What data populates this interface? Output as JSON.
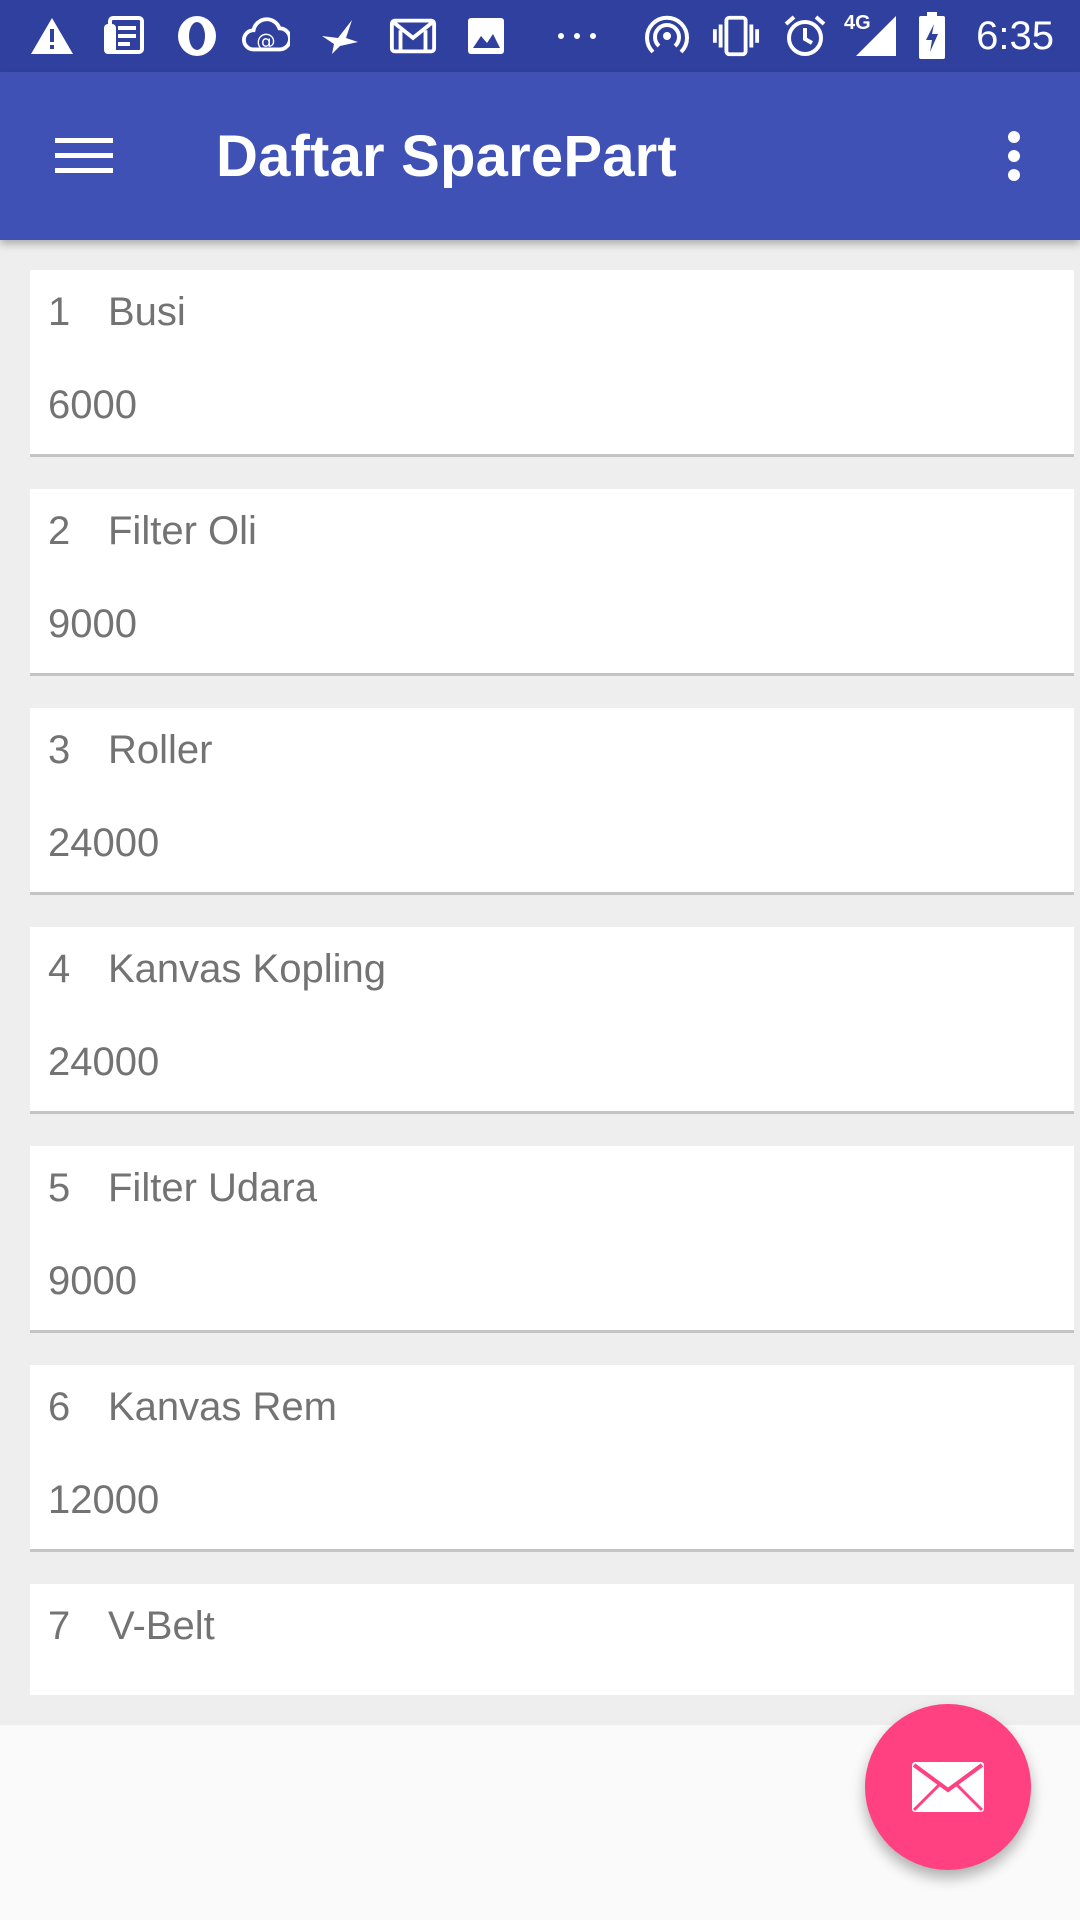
{
  "status_bar": {
    "time": "6:35",
    "network_label": "4G",
    "icons": [
      "warning-icon",
      "news-icon",
      "opera-icon",
      "cloud-mail-icon",
      "bird-icon",
      "gmail-icon",
      "gallery-icon",
      "more-notifications-icon",
      "hotspot-icon",
      "vibrate-icon",
      "alarm-icon",
      "signal-icon",
      "battery-charging-icon"
    ]
  },
  "app_bar": {
    "title": "Daftar SparePart",
    "color": "#3f51b5",
    "status_color": "#30409f"
  },
  "list": {
    "items": [
      {
        "number": "1",
        "name": "Busi",
        "price": "6000"
      },
      {
        "number": "2",
        "name": "Filter Oli",
        "price": "9000"
      },
      {
        "number": "3",
        "name": "Roller",
        "price": "24000"
      },
      {
        "number": "4",
        "name": "Kanvas Kopling",
        "price": "24000"
      },
      {
        "number": "5",
        "name": "Filter Udara",
        "price": "9000"
      },
      {
        "number": "6",
        "name": "Kanvas Rem",
        "price": "12000"
      },
      {
        "number": "7",
        "name": "V-Belt",
        "price": ""
      }
    ]
  },
  "fab": {
    "icon": "mail-icon",
    "color": "#ff4081"
  }
}
